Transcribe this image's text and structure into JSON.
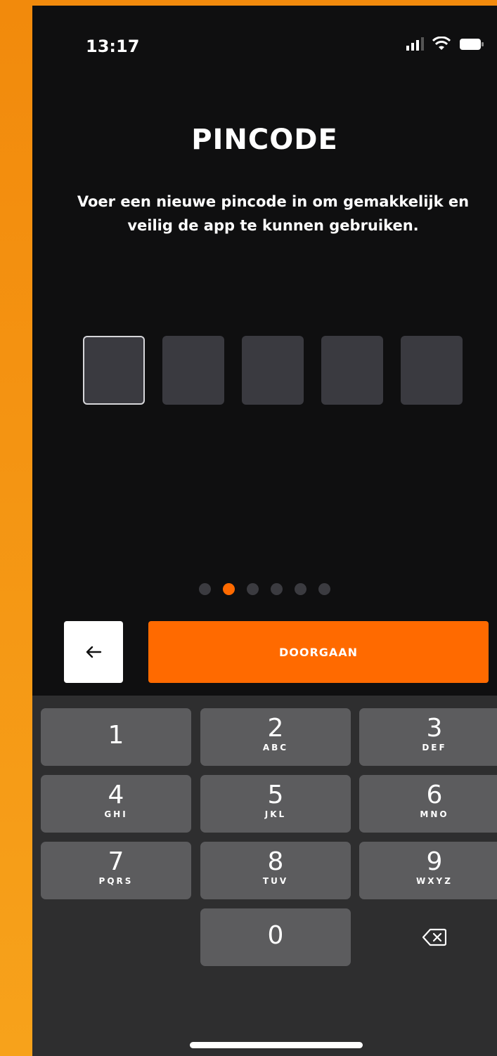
{
  "status_bar": {
    "time": "13:17"
  },
  "header": {
    "title": "PINCODE",
    "subtitle": "Voer een nieuwe pincode in om gemakkelijk en veilig de app te kunnen gebruiken."
  },
  "pin": {
    "length": 5,
    "filled": 0,
    "active_index": 0
  },
  "pagination": {
    "total": 6,
    "current": 2
  },
  "actions": {
    "back_icon": "arrow-left-icon",
    "continue_label": "DOORGAAN"
  },
  "keypad": {
    "keys": [
      {
        "digit": "1",
        "letters": ""
      },
      {
        "digit": "2",
        "letters": "ABC"
      },
      {
        "digit": "3",
        "letters": "DEF"
      },
      {
        "digit": "4",
        "letters": "GHI"
      },
      {
        "digit": "5",
        "letters": "JKL"
      },
      {
        "digit": "6",
        "letters": "MNO"
      },
      {
        "digit": "7",
        "letters": "PQRS"
      },
      {
        "digit": "8",
        "letters": "TUV"
      },
      {
        "digit": "9",
        "letters": "WXYZ"
      },
      {
        "digit": "0",
        "letters": ""
      }
    ],
    "delete_icon": "backspace-icon"
  },
  "colors": {
    "accent": "#ff6a00",
    "background": "#0f0f10",
    "keyboard": "#2e2e2f",
    "key": "#5c5c5e",
    "pin_box": "#3a3a40"
  }
}
